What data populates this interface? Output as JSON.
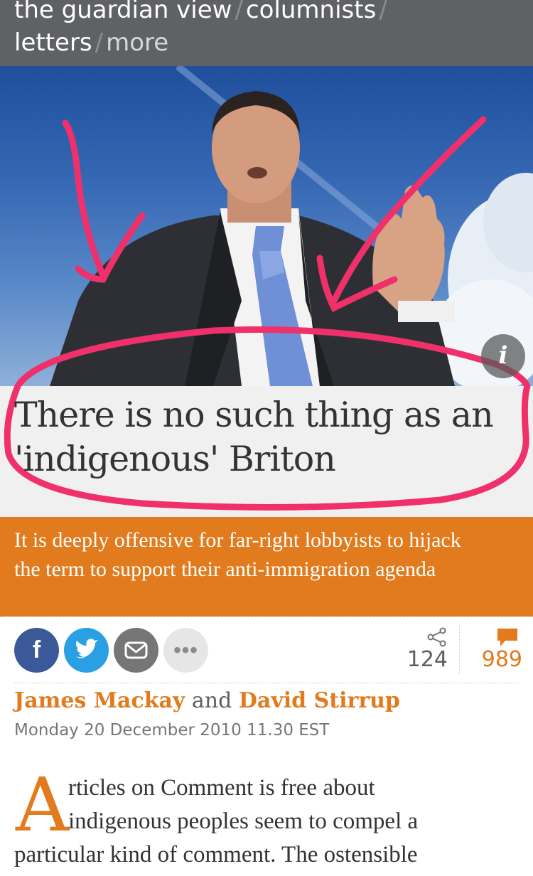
{
  "nav": {
    "items": [
      "the guardian view",
      "columnists",
      "letters",
      "more"
    ],
    "separator": "/"
  },
  "hero": {
    "info_label": "i",
    "image_subject": "photo of a man in a suit with raised hand against blue sky, annotated with pink arrows and a pink circle around the headline"
  },
  "article": {
    "headline_line1": "There is no such thing as an",
    "headline_line2": "'indigenous' Briton",
    "standfirst_line1": "It is deeply offensive for far-right lobbyists to hijack",
    "standfirst_line2": "the term to support their anti-immigration agenda",
    "share_count": "124",
    "comment_count": "989",
    "author1": "James Mackay",
    "byline_and": "and",
    "author2": "David Stirrup",
    "date": "Monday 20 December 2010 11.30 EST",
    "dropcap": "A",
    "body_line1": "rticles on Comment is free about",
    "body_line2": "indigenous peoples seem to compel a",
    "body_line3": "particular kind of comment. The ostensible"
  },
  "colors": {
    "nav_bg": "#5f6164",
    "accent_orange": "#e17b1d",
    "annotation_pink": "#f0306a",
    "facebook": "#3b5998",
    "twitter": "#2aa0e4"
  }
}
